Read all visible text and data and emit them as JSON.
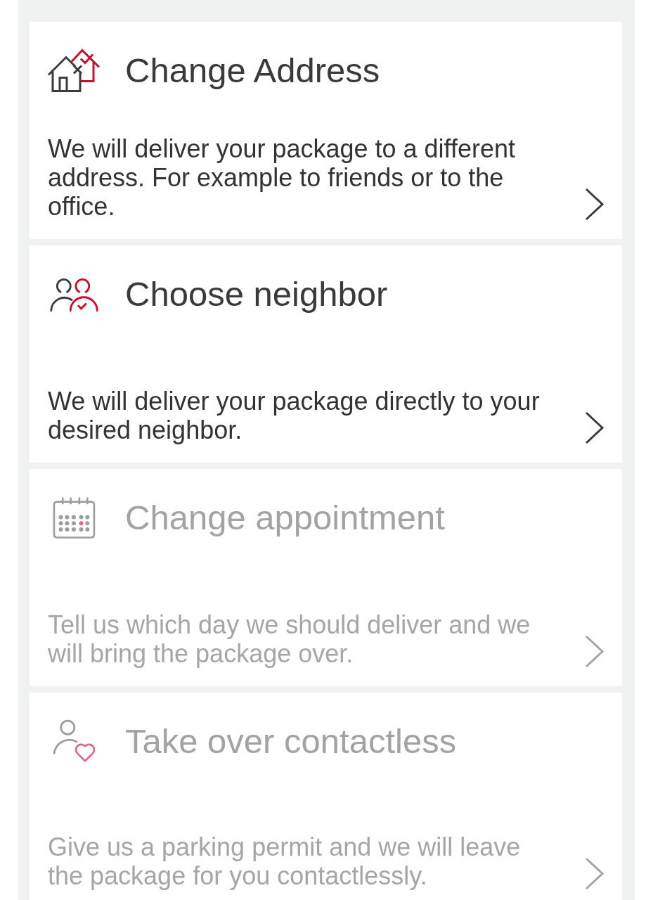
{
  "options": [
    {
      "kind": "address",
      "title": "Change Address",
      "description": "We will deliver your package to a different address. For example to friends or to the office.",
      "disabled": false
    },
    {
      "kind": "neighbor",
      "title": "Choose neighbor",
      "description": "We will deliver your package directly to your desired neighbor.",
      "disabled": false
    },
    {
      "kind": "appointment",
      "title": "Change appointment",
      "description": "Tell us which day we should deliver and we will bring the package over.",
      "disabled": true
    },
    {
      "kind": "contactless",
      "title": "Take over contactless",
      "description": "Give us a parking permit and we will leave the package for you contactlessly.",
      "disabled": true
    }
  ]
}
